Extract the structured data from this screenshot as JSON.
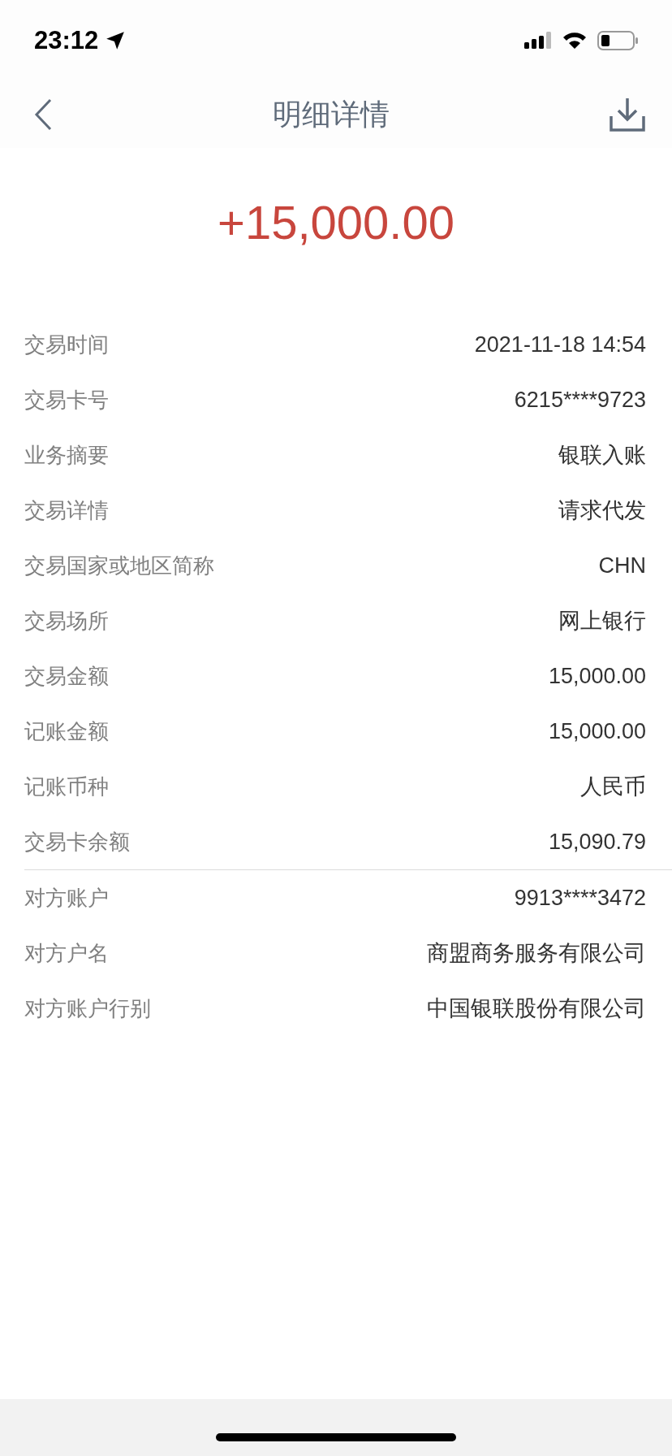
{
  "status_bar": {
    "time": "23:12"
  },
  "header": {
    "title": "明细详情"
  },
  "amount": "+15,000.00",
  "sections": [
    {
      "rows": [
        {
          "label": "交易时间",
          "value": "2021-11-18 14:54"
        },
        {
          "label": "交易卡号",
          "value": "6215****9723"
        },
        {
          "label": "业务摘要",
          "value": "银联入账"
        },
        {
          "label": "交易详情",
          "value": "请求代发"
        },
        {
          "label": "交易国家或地区简称",
          "value": "CHN"
        },
        {
          "label": "交易场所",
          "value": "网上银行"
        },
        {
          "label": "交易金额",
          "value": "15,000.00"
        },
        {
          "label": "记账金额",
          "value": "15,000.00"
        },
        {
          "label": "记账币种",
          "value": "人民币"
        },
        {
          "label": "交易卡余额",
          "value": "15,090.79"
        }
      ]
    },
    {
      "rows": [
        {
          "label": "对方账户",
          "value": "9913****3472"
        },
        {
          "label": "对方户名",
          "value": "商盟商务服务有限公司"
        },
        {
          "label": "对方账户行别",
          "value": "中国银联股份有限公司"
        }
      ]
    }
  ]
}
